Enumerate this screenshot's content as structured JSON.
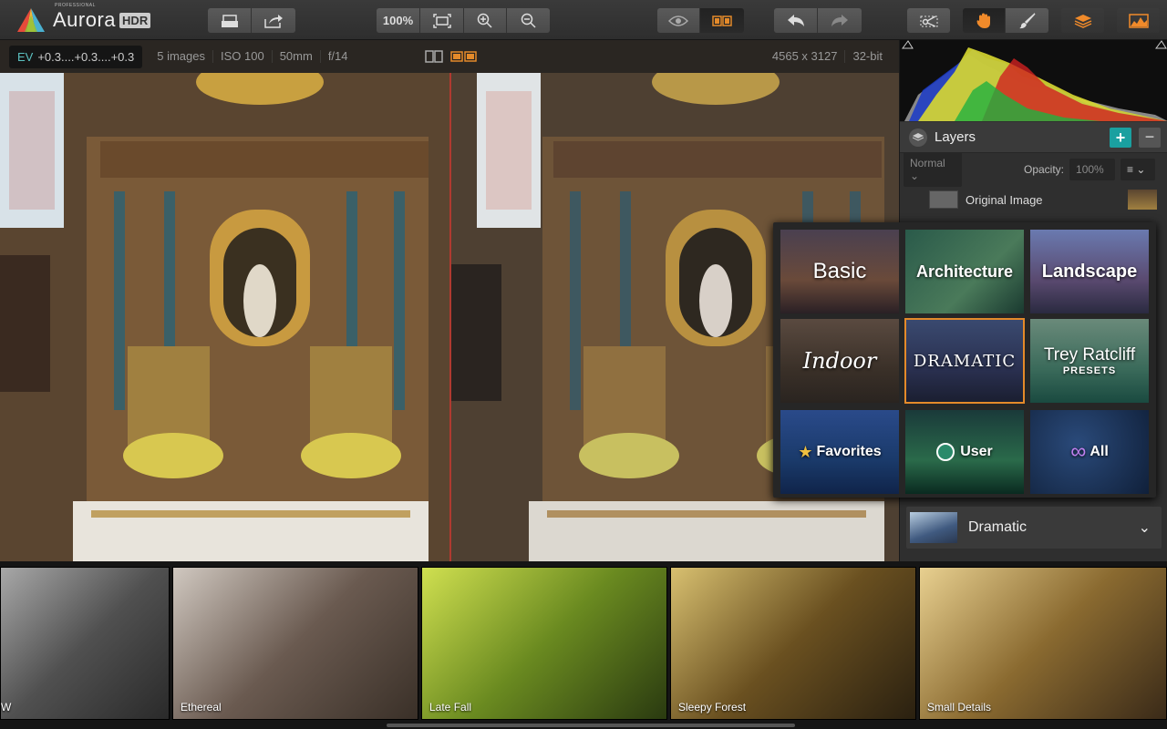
{
  "app": {
    "pro_label": "PROFESSIONAL",
    "name": "Aurora",
    "badge": "HDR"
  },
  "toolbar": {
    "zoom_label": "100%"
  },
  "infobar": {
    "ev_label": "EV",
    "ev_value": "+0.3....+0.3....+0.3",
    "images": "5 images",
    "iso": "ISO 100",
    "focal": "50mm",
    "aperture": "f/14",
    "dimensions": "4565 x 3127",
    "bitdepth": "32-bit"
  },
  "layers": {
    "title": "Layers",
    "blend_mode": "Normal",
    "opacity_label": "Opacity:",
    "opacity_value": "100%",
    "layer_name": "Original Image"
  },
  "presets": {
    "categories": [
      {
        "label": "Basic"
      },
      {
        "label": "Architecture"
      },
      {
        "label": "Landscape"
      },
      {
        "label": "Indoor"
      },
      {
        "label": "DRAMATIC"
      },
      {
        "label": "Trey Ratcliff",
        "sublabel": "PRESETS"
      },
      {
        "label": "Favorites"
      },
      {
        "label": "User"
      },
      {
        "label": "All"
      }
    ],
    "selected": "Dramatic"
  },
  "filmstrip": [
    {
      "label": "W"
    },
    {
      "label": "Ethereal"
    },
    {
      "label": "Late Fall"
    },
    {
      "label": "Sleepy Forest"
    },
    {
      "label": "Small Details"
    }
  ],
  "colors": {
    "accent": "#e48a2a",
    "teal": "#1aa0a0",
    "divider": "#b03a30"
  }
}
